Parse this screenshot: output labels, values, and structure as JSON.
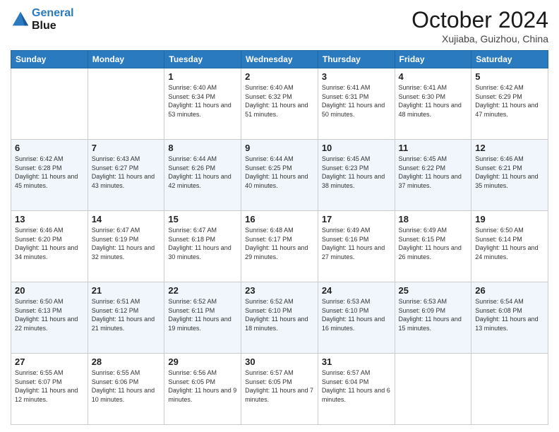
{
  "logo": {
    "line1": "General",
    "line2": "Blue"
  },
  "title": "October 2024",
  "subtitle": "Xujiaba, Guizhou, China",
  "days_of_week": [
    "Sunday",
    "Monday",
    "Tuesday",
    "Wednesday",
    "Thursday",
    "Friday",
    "Saturday"
  ],
  "weeks": [
    [
      {
        "day": "",
        "info": ""
      },
      {
        "day": "",
        "info": ""
      },
      {
        "day": "1",
        "info": "Sunrise: 6:40 AM\nSunset: 6:34 PM\nDaylight: 11 hours and 53 minutes."
      },
      {
        "day": "2",
        "info": "Sunrise: 6:40 AM\nSunset: 6:32 PM\nDaylight: 11 hours and 51 minutes."
      },
      {
        "day": "3",
        "info": "Sunrise: 6:41 AM\nSunset: 6:31 PM\nDaylight: 11 hours and 50 minutes."
      },
      {
        "day": "4",
        "info": "Sunrise: 6:41 AM\nSunset: 6:30 PM\nDaylight: 11 hours and 48 minutes."
      },
      {
        "day": "5",
        "info": "Sunrise: 6:42 AM\nSunset: 6:29 PM\nDaylight: 11 hours and 47 minutes."
      }
    ],
    [
      {
        "day": "6",
        "info": "Sunrise: 6:42 AM\nSunset: 6:28 PM\nDaylight: 11 hours and 45 minutes."
      },
      {
        "day": "7",
        "info": "Sunrise: 6:43 AM\nSunset: 6:27 PM\nDaylight: 11 hours and 43 minutes."
      },
      {
        "day": "8",
        "info": "Sunrise: 6:44 AM\nSunset: 6:26 PM\nDaylight: 11 hours and 42 minutes."
      },
      {
        "day": "9",
        "info": "Sunrise: 6:44 AM\nSunset: 6:25 PM\nDaylight: 11 hours and 40 minutes."
      },
      {
        "day": "10",
        "info": "Sunrise: 6:45 AM\nSunset: 6:23 PM\nDaylight: 11 hours and 38 minutes."
      },
      {
        "day": "11",
        "info": "Sunrise: 6:45 AM\nSunset: 6:22 PM\nDaylight: 11 hours and 37 minutes."
      },
      {
        "day": "12",
        "info": "Sunrise: 6:46 AM\nSunset: 6:21 PM\nDaylight: 11 hours and 35 minutes."
      }
    ],
    [
      {
        "day": "13",
        "info": "Sunrise: 6:46 AM\nSunset: 6:20 PM\nDaylight: 11 hours and 34 minutes."
      },
      {
        "day": "14",
        "info": "Sunrise: 6:47 AM\nSunset: 6:19 PM\nDaylight: 11 hours and 32 minutes."
      },
      {
        "day": "15",
        "info": "Sunrise: 6:47 AM\nSunset: 6:18 PM\nDaylight: 11 hours and 30 minutes."
      },
      {
        "day": "16",
        "info": "Sunrise: 6:48 AM\nSunset: 6:17 PM\nDaylight: 11 hours and 29 minutes."
      },
      {
        "day": "17",
        "info": "Sunrise: 6:49 AM\nSunset: 6:16 PM\nDaylight: 11 hours and 27 minutes."
      },
      {
        "day": "18",
        "info": "Sunrise: 6:49 AM\nSunset: 6:15 PM\nDaylight: 11 hours and 26 minutes."
      },
      {
        "day": "19",
        "info": "Sunrise: 6:50 AM\nSunset: 6:14 PM\nDaylight: 11 hours and 24 minutes."
      }
    ],
    [
      {
        "day": "20",
        "info": "Sunrise: 6:50 AM\nSunset: 6:13 PM\nDaylight: 11 hours and 22 minutes."
      },
      {
        "day": "21",
        "info": "Sunrise: 6:51 AM\nSunset: 6:12 PM\nDaylight: 11 hours and 21 minutes."
      },
      {
        "day": "22",
        "info": "Sunrise: 6:52 AM\nSunset: 6:11 PM\nDaylight: 11 hours and 19 minutes."
      },
      {
        "day": "23",
        "info": "Sunrise: 6:52 AM\nSunset: 6:10 PM\nDaylight: 11 hours and 18 minutes."
      },
      {
        "day": "24",
        "info": "Sunrise: 6:53 AM\nSunset: 6:10 PM\nDaylight: 11 hours and 16 minutes."
      },
      {
        "day": "25",
        "info": "Sunrise: 6:53 AM\nSunset: 6:09 PM\nDaylight: 11 hours and 15 minutes."
      },
      {
        "day": "26",
        "info": "Sunrise: 6:54 AM\nSunset: 6:08 PM\nDaylight: 11 hours and 13 minutes."
      }
    ],
    [
      {
        "day": "27",
        "info": "Sunrise: 6:55 AM\nSunset: 6:07 PM\nDaylight: 11 hours and 12 minutes."
      },
      {
        "day": "28",
        "info": "Sunrise: 6:55 AM\nSunset: 6:06 PM\nDaylight: 11 hours and 10 minutes."
      },
      {
        "day": "29",
        "info": "Sunrise: 6:56 AM\nSunset: 6:05 PM\nDaylight: 11 hours and 9 minutes."
      },
      {
        "day": "30",
        "info": "Sunrise: 6:57 AM\nSunset: 6:05 PM\nDaylight: 11 hours and 7 minutes."
      },
      {
        "day": "31",
        "info": "Sunrise: 6:57 AM\nSunset: 6:04 PM\nDaylight: 11 hours and 6 minutes."
      },
      {
        "day": "",
        "info": ""
      },
      {
        "day": "",
        "info": ""
      }
    ]
  ]
}
